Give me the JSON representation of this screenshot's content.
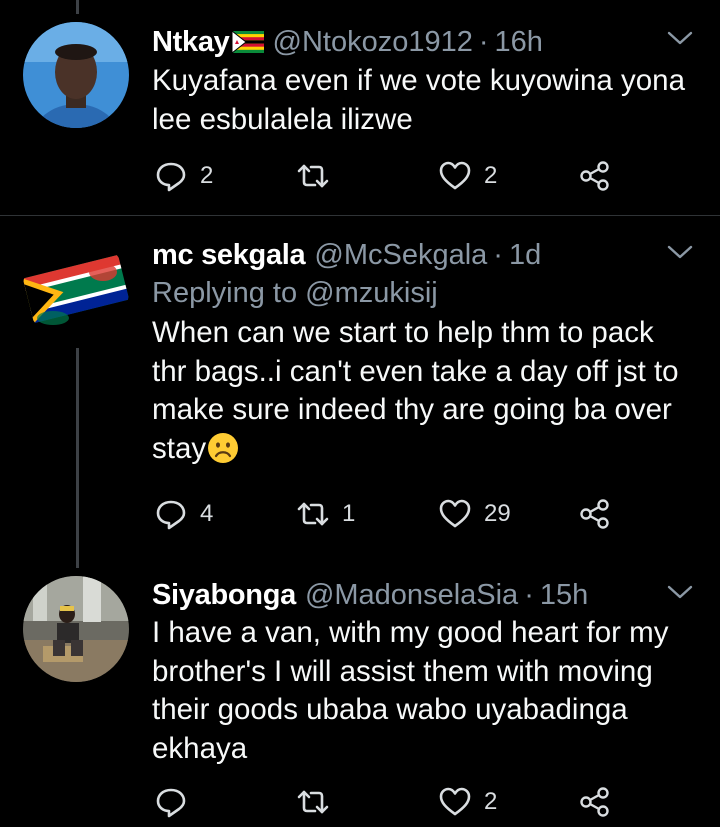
{
  "tweets": [
    {
      "name": "Ntkay",
      "handle": "@Ntokozo1912",
      "separator": "·",
      "time": "16h",
      "reply_to_label": "",
      "reply_to_handle": "",
      "text": "Kuyafana even if we vote kuyowina yona\nlee esbulalela ilizwe",
      "reply_count": "2",
      "retweet_count": "",
      "like_count": "2"
    },
    {
      "name": "mc sekgala",
      "handle": "@McSekgala",
      "separator": "·",
      "time": "1d",
      "reply_to_label": "Replying to",
      "reply_to_handle": "@mzukisij",
      "text": "When can we start to help thm to pack\nthr bags..i can't even take a day off jst to\nmake sure indeed thy are going ba over\nstay",
      "reply_count": "4",
      "retweet_count": "1",
      "like_count": "29"
    },
    {
      "name": "Siyabonga",
      "handle": "@MadonselaSia",
      "separator": "·",
      "time": "15h",
      "reply_to_label": "",
      "reply_to_handle": "",
      "text": "I have a van, with my good heart for my\nbrother's I will assist them with moving\ntheir goods ubaba wabo uyabadinga\nekhaya",
      "reply_count": "",
      "retweet_count": "",
      "like_count": "2"
    }
  ],
  "icons": {
    "reply": "reply-icon",
    "retweet": "retweet-icon",
    "like": "heart-icon",
    "share": "share-icon",
    "more": "chevron-down-icon",
    "emoji": "frowning-face-emoji",
    "flag": "zimbabwe-flag-emoji"
  },
  "colors": {
    "background": "#000000",
    "secondary_text": "#8b98a5",
    "divider": "#2f3336",
    "thread_line": "#3d4146"
  }
}
